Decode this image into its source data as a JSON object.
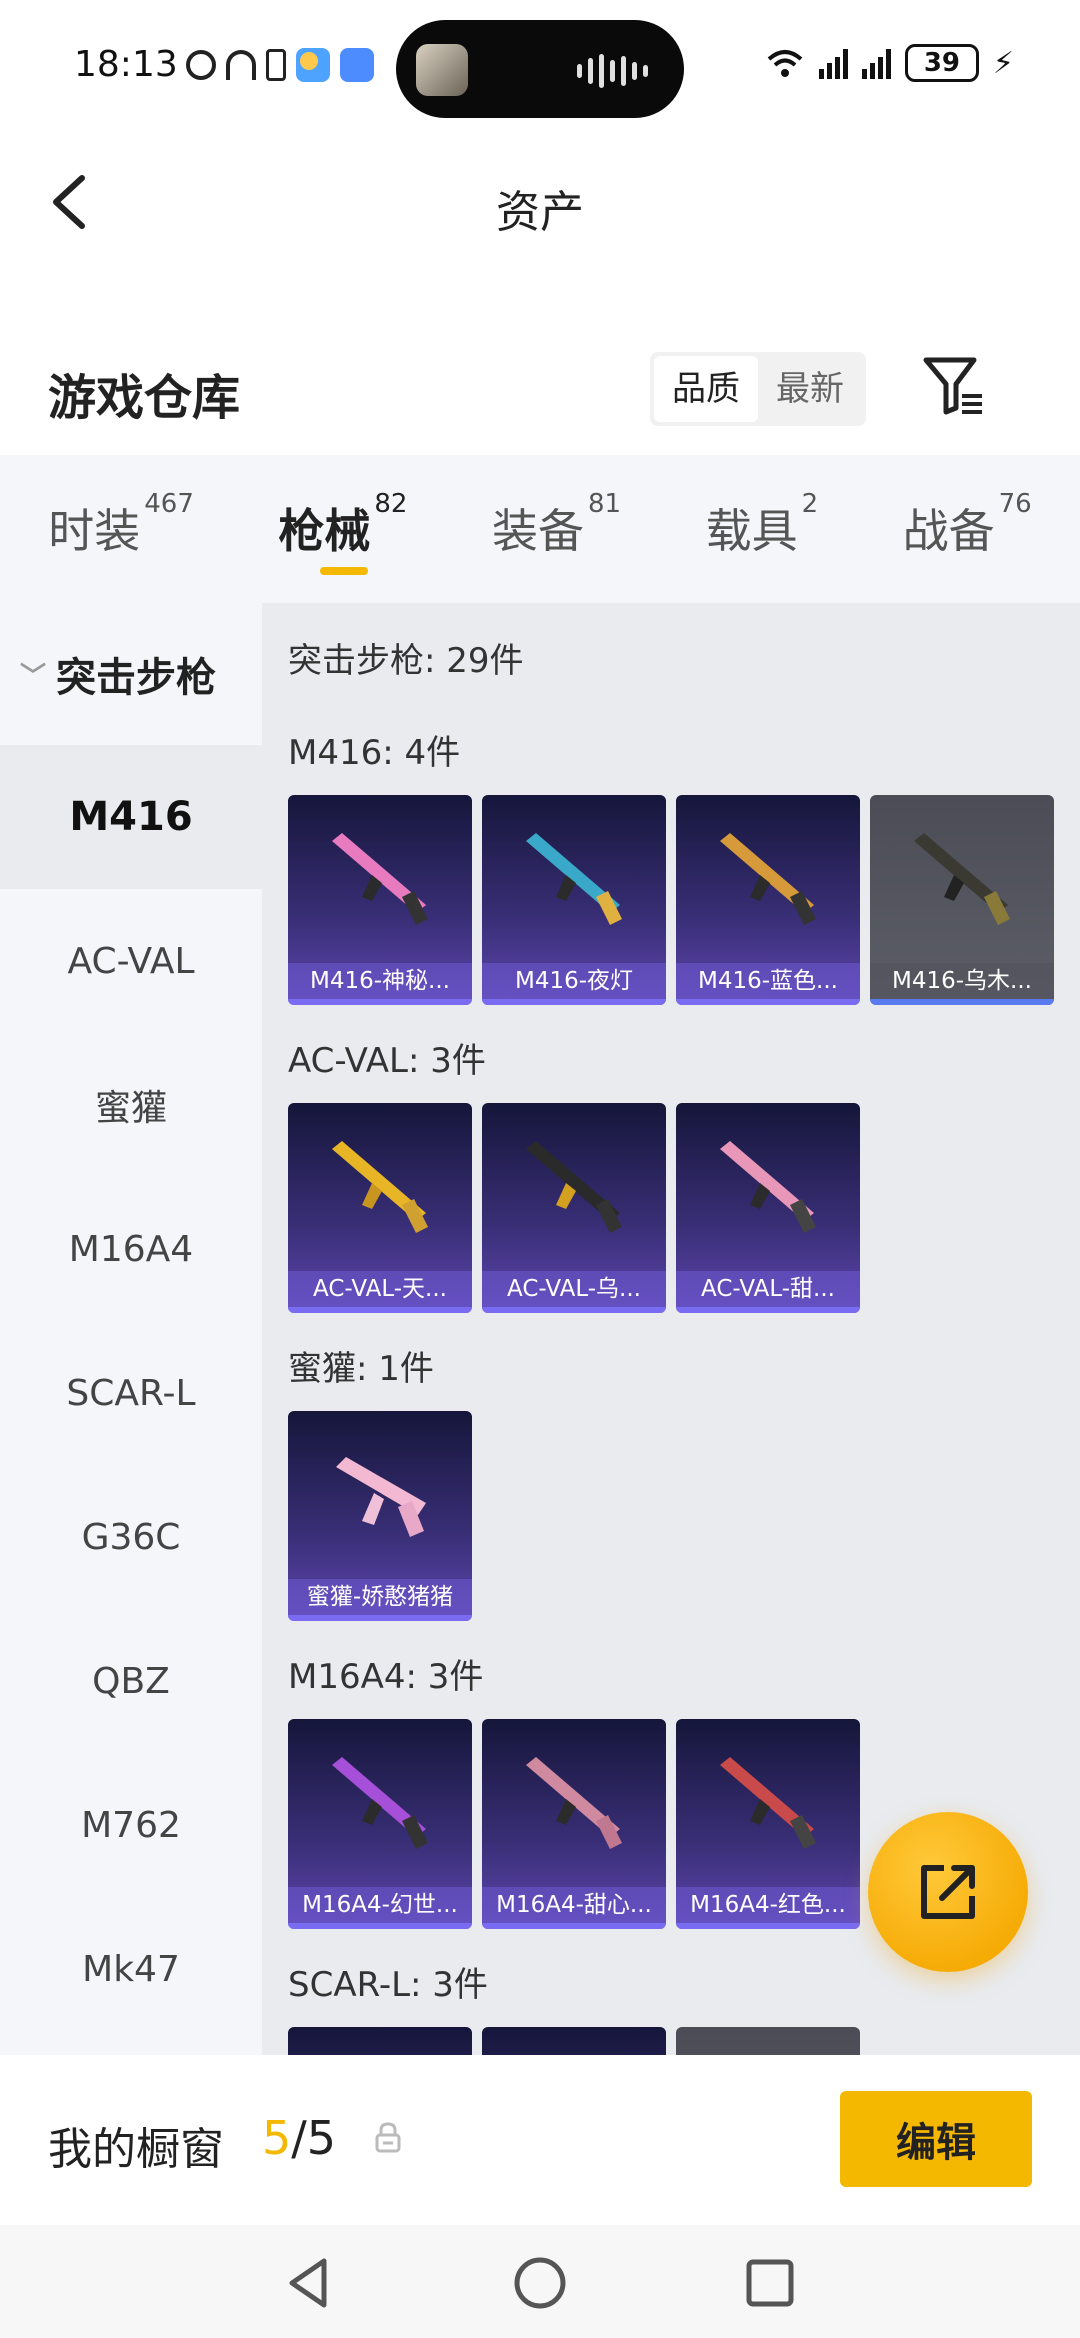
{
  "status_bar": {
    "time": "18:13",
    "battery": "39"
  },
  "header": {
    "title": "资产"
  },
  "warehouse": {
    "title": "游戏仓库",
    "sort_options": [
      "品质",
      "最新"
    ],
    "active_sort": "品质"
  },
  "tabs": [
    {
      "label": "时装",
      "count": "467"
    },
    {
      "label": "枪械",
      "count": "82"
    },
    {
      "label": "装备",
      "count": "81"
    },
    {
      "label": "载具",
      "count": "2"
    },
    {
      "label": "战备",
      "count": "76"
    }
  ],
  "sidebar": {
    "group": "突击步枪",
    "items": [
      "M416",
      "AC-VAL",
      "蜜獾",
      "M16A4",
      "SCAR-L",
      "G36C",
      "QBZ",
      "M762",
      "Mk47"
    ],
    "active": "M416"
  },
  "content": {
    "total": "突击步枪: 29件",
    "sections": [
      {
        "label": "M416: 4件",
        "cards": [
          "M416-神秘...",
          "M416-夜灯",
          "M416-蓝色...",
          "M416-乌木..."
        ]
      },
      {
        "label": "AC-VAL: 3件",
        "cards": [
          "AC-VAL-天...",
          "AC-VAL-乌...",
          "AC-VAL-甜..."
        ]
      },
      {
        "label": "蜜獾: 1件",
        "cards": [
          "蜜獾-娇憨猪猪"
        ]
      },
      {
        "label": "M16A4: 3件",
        "cards": [
          "M16A4-幻世...",
          "M16A4-甜心...",
          "M16A4-红色..."
        ]
      },
      {
        "label": "SCAR-L: 3件",
        "cards": []
      }
    ]
  },
  "showcase": {
    "label": "我的橱窗",
    "count_current": "5",
    "count_sep": "/5",
    "edit_label": "编辑"
  },
  "colors": {
    "accent": "#f5b800",
    "card_gradient_top": "#15163a",
    "card_gradient_bottom": "#5f47b0",
    "sidebar_bg": "#f4f6f9",
    "content_bg": "#e9ebef"
  },
  "icons": {
    "back": "chevron-left-icon",
    "filter": "filter-icon",
    "share": "share-external-icon",
    "lock": "lock-icon"
  }
}
